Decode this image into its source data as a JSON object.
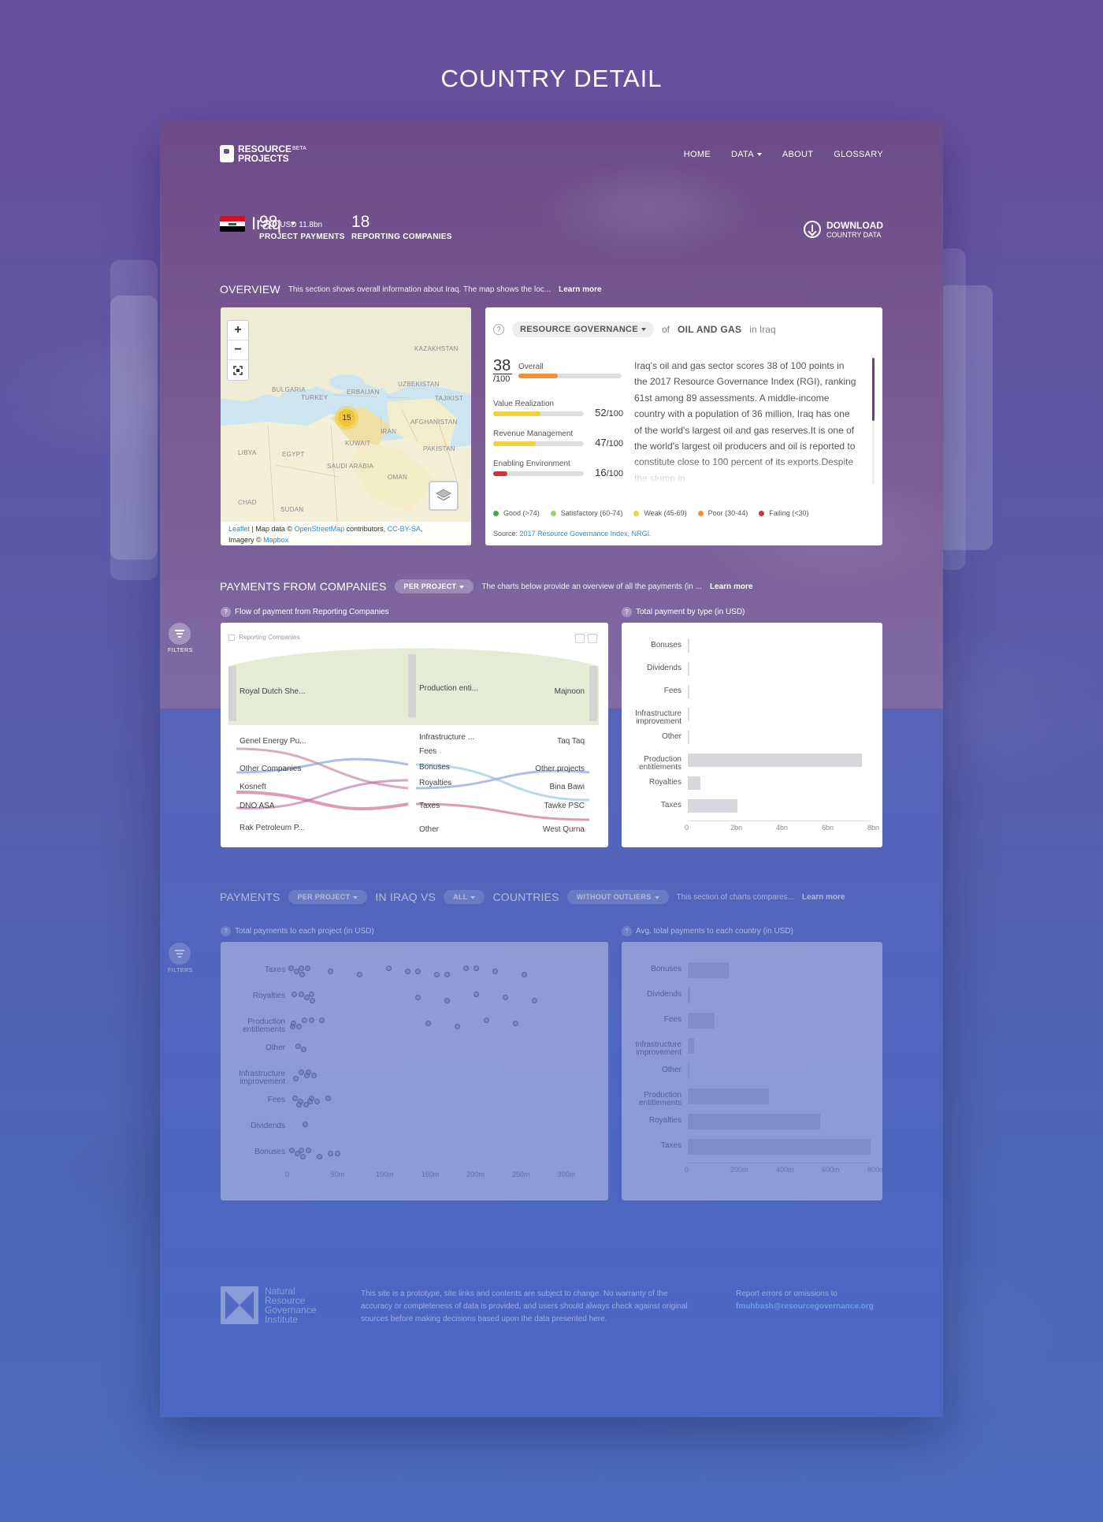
{
  "page": {
    "heading": "COUNTRY DETAIL"
  },
  "nav": {
    "logo_line1": "RESOURCE",
    "logo_beta": "BETA",
    "logo_line2": "PROJECTS",
    "items": [
      "HOME",
      "DATA",
      "ABOUT",
      "GLOSSARY"
    ]
  },
  "country": {
    "name": "Iraq",
    "project_payments_num": "98",
    "project_payments_usd": "USD 11.8bn",
    "project_payments_label": "PROJECT PAYMENTS",
    "reporting_num": "18",
    "reporting_label": "REPORTING COMPANIES",
    "download_line1": "DOWNLOAD",
    "download_line2": "COUNTRY DATA"
  },
  "overview": {
    "title": "OVERVIEW",
    "desc": "This section shows overall information about Iraq. The map shows the loc...",
    "learn_more": "Learn more"
  },
  "map": {
    "zoom_in": "+",
    "zoom_out": "−",
    "cluster_count": "15",
    "labels": [
      "KAZAKHSTAN",
      "UZBEKISTAN",
      "BULGARIA",
      "TURKEY",
      "ERBAIJAN",
      "TAJIKIST",
      "AFGHANISTAN",
      "IRAN",
      "KUWAIT",
      "LIBYA",
      "EGYPT",
      "PAKISTAN",
      "SAUDI ARABIA",
      "OMAN",
      "CHAD",
      "SUDAN"
    ],
    "attr_leaflet": "Leaflet",
    "attr_mapdata": "| Map data ©",
    "attr_osm": "OpenStreetMap",
    "attr_contrib": "contributors,",
    "attr_cc": "CC-BY-SA",
    "attr_imagery": "Imagery ©",
    "attr_mapbox": "Mapbox"
  },
  "governance": {
    "q": "?",
    "selector": "RESOURCE GOVERNANCE",
    "of": "of",
    "sector": "OIL AND GAS",
    "in": "in Iraq",
    "overall_score": "38",
    "overall_den": "/100",
    "overall_label": "Overall",
    "overall_fraction": 0.38,
    "rows": [
      {
        "label": "Value Realization",
        "score": "52",
        "den": "/100",
        "fraction": 0.52,
        "color": "#f2d13c"
      },
      {
        "label": "Revenue Management",
        "score": "47",
        "den": "/100",
        "fraction": 0.47,
        "color": "#f2d13c"
      },
      {
        "label": "Enabling Environment",
        "score": "16",
        "den": "/100",
        "fraction": 0.16,
        "color": "#c2393b"
      }
    ],
    "overall_color": "#f0913a",
    "text": "Iraq's oil and gas sector scores 38 of 100 points in the 2017 Resource Governance Index (RGI), ranking 61st among 89 assessments. A middle-income country with a population of 36 million, Iraq has one of the world's largest oil and gas reserves.It is one of the world's largest oil producers and oil is reported to constitute close to 100 percent of its exports.Despite the slump in",
    "legend": [
      {
        "label": "Good (>74)",
        "color": "#4aa83e"
      },
      {
        "label": "Satisfactory (60-74)",
        "color": "#9fd35c"
      },
      {
        "label": "Weak (45-69)",
        "color": "#f2d13c"
      },
      {
        "label": "Poor (30-44)",
        "color": "#f0913a"
      },
      {
        "label": "Failing (<30)",
        "color": "#c2393b"
      }
    ],
    "source_label": "Source:",
    "source_link": "2017 Resource Governance Index, NRGI."
  },
  "payments": {
    "title": "PAYMENTS FROM COMPANIES",
    "selector": "PER PROJECT",
    "desc": "The charts below provide an overview of all the payments (in ...",
    "learn_more": "Learn more",
    "filters": "FILTERS",
    "flow_caption": "Flow of payment from Reporting Companies",
    "type_caption": "Total payment by type (in USD)",
    "sankey_header": "Reporting Companies",
    "sankey_left": [
      "Royal Dutch She...",
      "Genel Energy Pu...",
      "Other Companies",
      "Kosneft",
      "DNO ASA",
      "Rak Petroleum P..."
    ],
    "sankey_mid": [
      "Production enti...",
      "Infrastructure ...",
      "Fees",
      "Bonuses",
      "Royalties",
      "Taxes",
      "Other"
    ],
    "sankey_right": [
      "Majnoon",
      "Taq Taq",
      "Other projects",
      "Bina Bawi",
      "Tawke PSC",
      "West Qurna"
    ]
  },
  "chart_data": [
    {
      "type": "bar",
      "title": "Total payment by type (in USD)",
      "categories": [
        "Bonuses",
        "Dividends",
        "Fees",
        "Infrastructure improvement",
        "Other",
        "Production entitlements",
        "Royalties",
        "Taxes"
      ],
      "values": [
        0.05,
        0.0,
        0.05,
        0.0,
        0.0,
        8.1,
        0.6,
        2.3
      ],
      "xticks": [
        "0",
        "2bn",
        "4bn",
        "6bn",
        "8bn"
      ],
      "xlim": [
        0,
        8.5
      ],
      "units": "bn USD"
    },
    {
      "type": "bar",
      "title": "Avg. total payments to each country (in USD)",
      "categories": [
        "Bonuses",
        "Dividends",
        "Fees",
        "Infrastructure improvement",
        "Other",
        "Production entitlements",
        "Royalties",
        "Taxes"
      ],
      "values": [
        200,
        10,
        130,
        30,
        5,
        400,
        650,
        900
      ],
      "xticks": [
        "0",
        "200m",
        "400m",
        "600m",
        "800m"
      ],
      "xlim": [
        0,
        900
      ],
      "units": "m USD"
    },
    {
      "type": "scatter",
      "title": "Total payments to each project (in USD)",
      "categories": [
        "Taxes",
        "Royalties",
        "Production entitlements",
        "Other",
        "Infrastructure improvement",
        "Fees",
        "Dividends",
        "Bonuses"
      ],
      "xticks": [
        "0",
        "50m",
        "100m",
        "150m",
        "200m",
        "250m",
        "300m"
      ],
      "xlim": [
        0,
        330
      ]
    }
  ],
  "compare": {
    "title_a": "PAYMENTS",
    "sel1": "PER PROJECT",
    "title_b": "IN IRAQ VS",
    "sel2": "ALL",
    "title_c": "COUNTRIES",
    "sel3": "WITHOUT OUTLIERS",
    "desc": "This section of charts compares...",
    "learn_more": "Learn more",
    "filters": "FILTERS",
    "cap1": "Total payments to each project (in USD)",
    "cap2": "Avg. total payments to each country (in USD)"
  },
  "footer": {
    "org": "Natural Resource Governance Institute",
    "disclaimer": "This site is a prototype, site links and contents are subject to change. No warranty of the accuracy or completeness of data is provided, and users should always check against original sources before making decisions based upon the data presented here.",
    "report_label": "Report errors or omissions to",
    "report_email": "fmuhbash@resourcegovernance.org"
  }
}
